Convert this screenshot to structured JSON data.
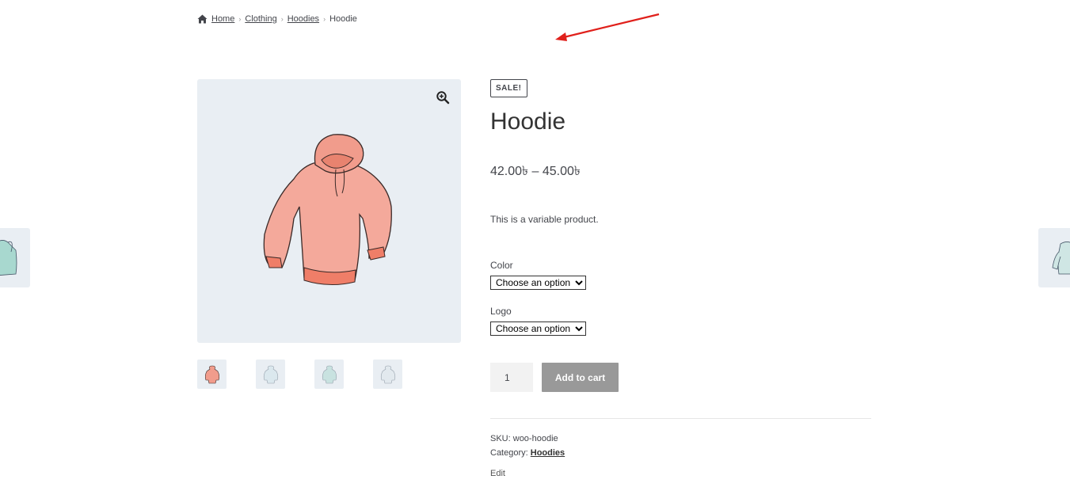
{
  "breadcrumb": {
    "home_icon": "home-icon",
    "items": [
      "Home",
      "Clothing",
      "Hoodies"
    ],
    "current": "Hoodie"
  },
  "gallery": {
    "zoom_icon": "magnifier-zoom-icon",
    "thumbnail_count": 4
  },
  "product": {
    "badge": "SALE!",
    "title": "Hoodie",
    "price_from": "42.00৳",
    "price_sep": "–",
    "price_to": "45.00৳",
    "description": "This is a variable product.",
    "attributes": [
      {
        "label": "Color",
        "selected": "Choose an option"
      },
      {
        "label": "Logo",
        "selected": "Choose an option"
      }
    ],
    "quantity": "1",
    "add_to_cart": "Add to cart",
    "sku_label": "SKU:",
    "sku_value": "woo-hoodie",
    "category_label": "Category:",
    "category_value": "Hoodies",
    "edit": "Edit"
  },
  "colors": {
    "accent": "#999999",
    "gallery_bg": "#e9eef3",
    "annotation_arrow": "#e0201b",
    "hoodie_main": "#f19c8c"
  }
}
